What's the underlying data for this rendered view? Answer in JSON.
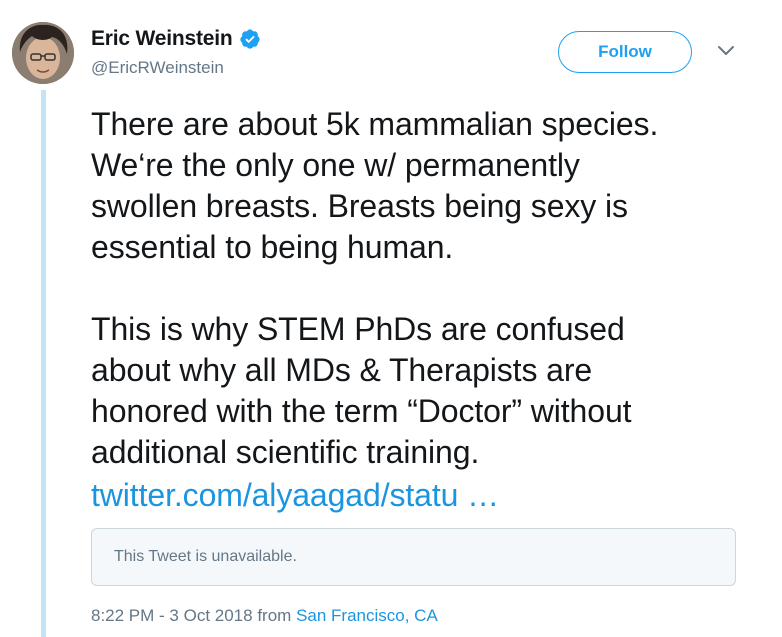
{
  "author": {
    "display_name": "Eric Weinstein",
    "handle": "@EricRWeinstein",
    "verified": true
  },
  "actions": {
    "follow_label": "Follow"
  },
  "tweet": {
    "paragraph_1_lines": [
      "There are about 5k mammalian species.",
      "We‘re the only one w/ permanently",
      "swollen breasts. Breasts being sexy is",
      "essential to being human."
    ],
    "paragraph_2_lines": [
      "This is why STEM PhDs are confused",
      "about why all MDs & Therapists are",
      "honored with the term “Doctor” without",
      "additional scientific training."
    ],
    "link_text": "twitter.com/alyaagad/statu …"
  },
  "quoted_tweet": {
    "text": "This Tweet is unavailable."
  },
  "meta": {
    "timestamp": "8:22 PM - 3 Oct 2018",
    "from_label": "from",
    "location": "San Francisco, CA"
  },
  "colors": {
    "accent": "#1da1f2",
    "link": "#1b95e0",
    "secondary_text": "#657786",
    "thread_line": "#c4e4f6"
  }
}
